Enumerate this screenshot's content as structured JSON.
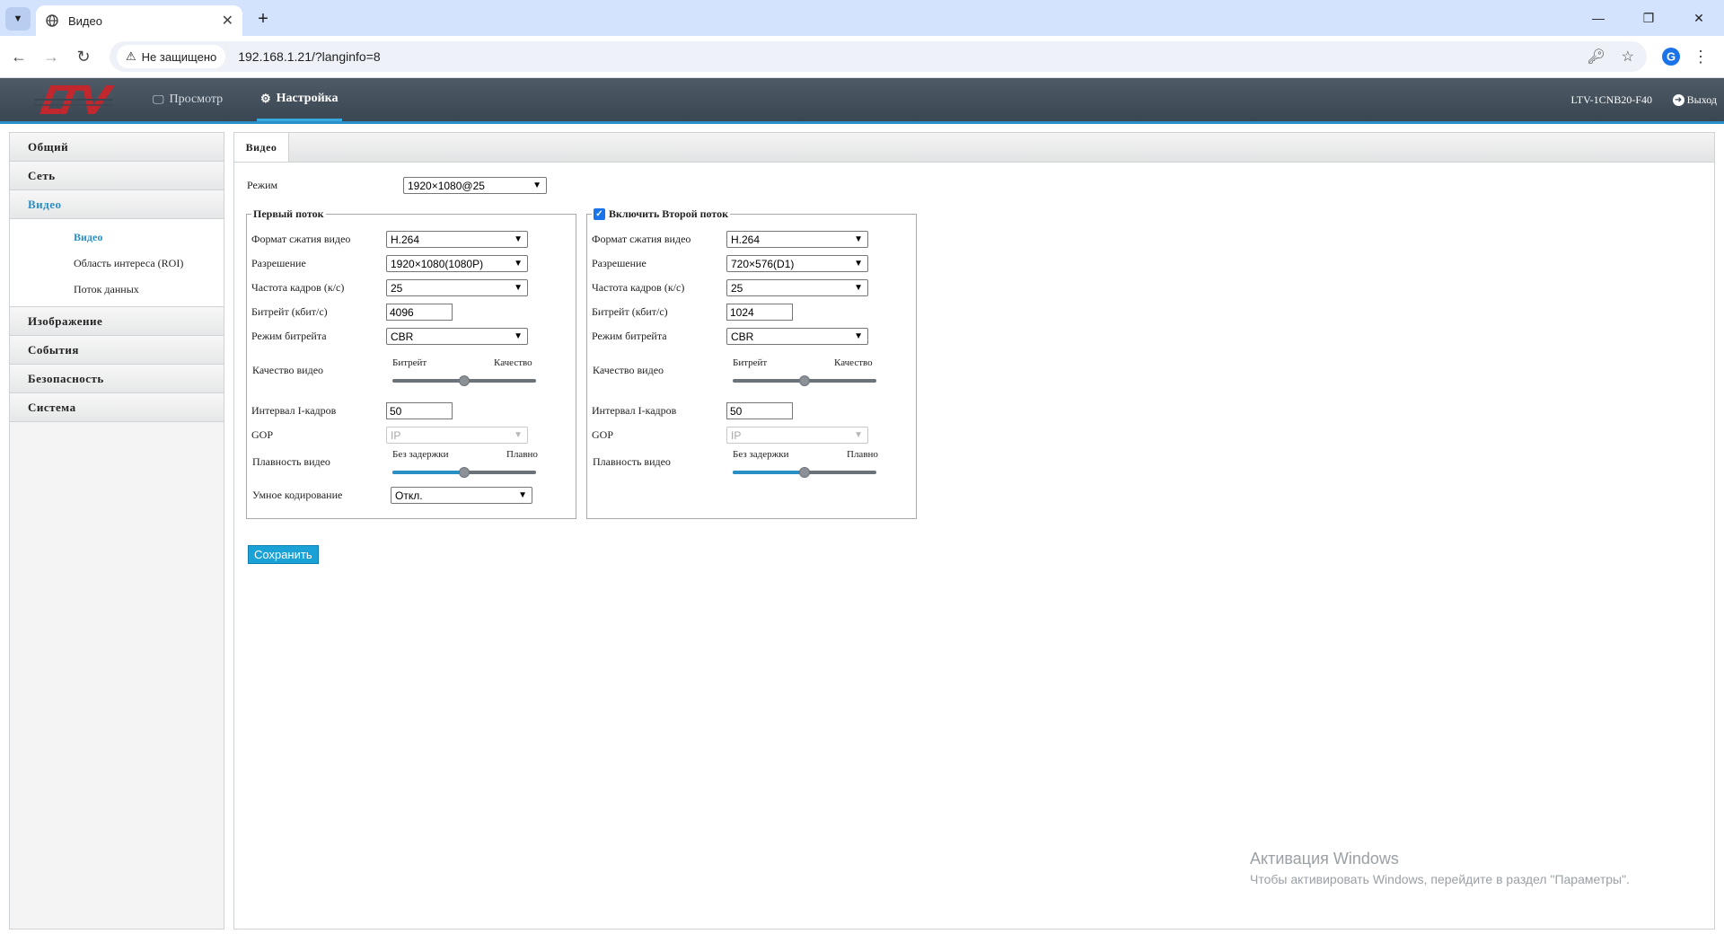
{
  "browser": {
    "tab_title": "Видео",
    "security_label": "Не защищено",
    "url": "192.168.1.21/?langinfo=8"
  },
  "header": {
    "nav_preview": "Просмотр",
    "nav_settings": "Настройка",
    "device_name": "LTV-1CNB20-F40",
    "logout": "Выход"
  },
  "sidebar": {
    "items": [
      "Общий",
      "Сеть",
      "Видео",
      "Изображение",
      "События",
      "Безопасность",
      "Система"
    ],
    "video_sub": [
      "Видео",
      "Область интереса (ROI)",
      "Поток данных"
    ]
  },
  "main": {
    "tab": "Видео",
    "mode_label": "Режим",
    "mode_value": "1920×1080@25",
    "save_label": "Сохранить"
  },
  "labels": {
    "codec": "Формат сжатия видео",
    "resolution": "Разрешение",
    "framerate": "Частота кадров (к/с)",
    "bitrate": "Битрейт (кбит/с)",
    "bitrate_mode": "Режим битрейта",
    "quality": "Качество видео",
    "quality_left": "Битрейт",
    "quality_right": "Качество",
    "iframe": "Интервал I-кадров",
    "gop": "GOP",
    "smoothness": "Плавность видео",
    "smooth_left": "Без задержки",
    "smooth_right": "Плавно",
    "smart": "Умное кодирование"
  },
  "stream1": {
    "title": "Первый поток",
    "codec": "H.264",
    "resolution": "1920×1080(1080P)",
    "framerate": "25",
    "bitrate": "4096",
    "bitrate_mode": "CBR",
    "quality_level": 0.5,
    "iframe": "50",
    "gop": "IP",
    "smooth_level": 0.5,
    "smart": "Откл."
  },
  "stream2": {
    "enable_label": "Включить",
    "title": "Второй поток",
    "enabled": true,
    "codec": "H.264",
    "resolution": "720×576(D1)",
    "framerate": "25",
    "bitrate": "1024",
    "bitrate_mode": "CBR",
    "quality_level": 0.5,
    "iframe": "50",
    "gop": "IP",
    "smooth_level": 0.5
  },
  "watermark": {
    "title": "Активация Windows",
    "subtitle": "Чтобы активировать Windows, перейдите в раздел \"Параметры\"."
  },
  "colors": {
    "accent": "#2a8fc4",
    "header_bg": "#3a4652",
    "save_button": "#1aa1d6"
  }
}
